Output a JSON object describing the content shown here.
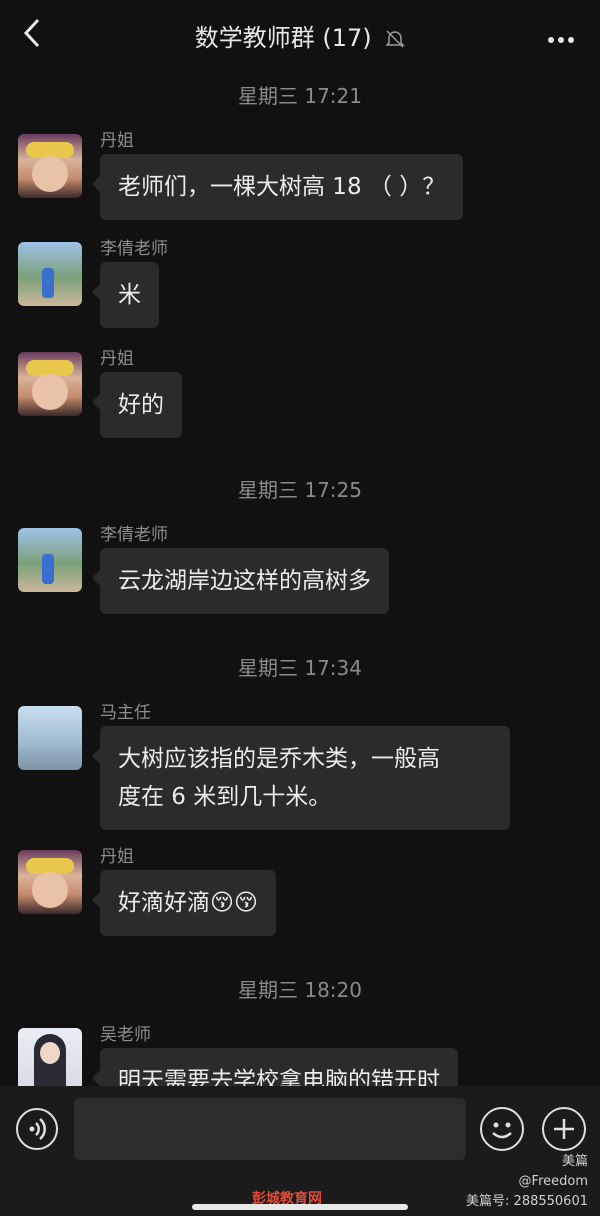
{
  "header": {
    "title": "数学教师群 (17)",
    "back_icon": "chevron-left-icon",
    "mute_icon": "bell-off-icon",
    "more_icon": "more-dots-icon"
  },
  "chat": {
    "timestamps": [
      "星期三 17:21",
      "星期三 17:25",
      "星期三 17:34",
      "星期三 18:20"
    ],
    "messages": [
      {
        "sender": "丹姐",
        "text": "老师们，一棵大树高 18 （  ）？"
      },
      {
        "sender": "李倩老师",
        "text": "米"
      },
      {
        "sender": "丹姐",
        "text": "好的"
      },
      {
        "sender": "李倩老师",
        "text": "云龙湖岸边这样的高树多"
      },
      {
        "sender": "马主任",
        "text_line1": "大树应该指的是乔木类，一般高",
        "text_line2": "度在 6 米到几十米。"
      },
      {
        "sender": "丹姐",
        "text": "好滴好滴😚😚"
      },
      {
        "sender": "吴老师",
        "text": "明天需要去学校拿电脑的错开时"
      }
    ]
  },
  "input_bar": {
    "voice_icon": "voice-icon",
    "emoji_icon": "smiley-icon",
    "plus_icon": "plus-icon"
  },
  "watermark": {
    "brand": "美篇",
    "user": "@Freedom",
    "id": "美篇号: 288550601",
    "site": "彭城教育网"
  }
}
